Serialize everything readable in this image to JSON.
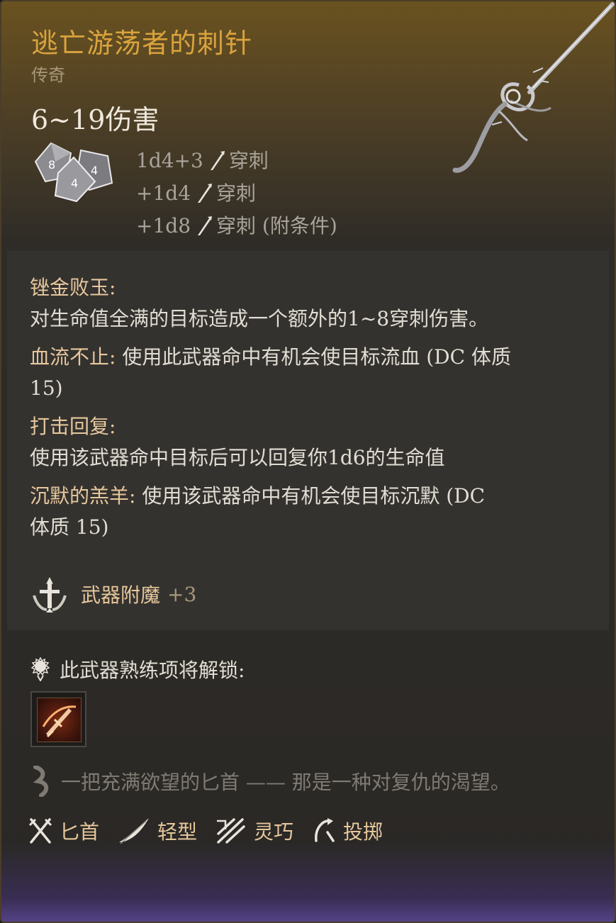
{
  "item": {
    "name": "逃亡游荡者的刺针",
    "rarity": "传奇",
    "damage_total": "6~19伤害",
    "damage_lines": [
      {
        "dice": "1d4+3",
        "type": "穿刺",
        "icon": "piercing-icon"
      },
      {
        "dice": "+1d4",
        "type": "穿刺",
        "icon": "piercing-icon"
      },
      {
        "dice": "+1d8",
        "type": "穿刺 (附条件)",
        "icon": "piercing-icon"
      }
    ],
    "art_icon": "dagger-art"
  },
  "perks": [
    {
      "name": "锉金败玉:",
      "desc": "对生命值全满的目标造成一个额外的1~8穿刺伤害。"
    },
    {
      "name": "血流不止:",
      "desc": " 使用此武器命中有机会使目标流血 (DC 体质 15)"
    },
    {
      "name": "打击回复:",
      "desc": "使用该武器命中目标后可以回复你1d6的生命值"
    },
    {
      "name": "沉默的羔羊:",
      "desc": " 使用该武器命中有机会使目标沉默 (DC 体质 15)"
    }
  ],
  "enchant": {
    "label": "武器附魔",
    "value": "+3",
    "icon": "enchant-icon"
  },
  "proficiency": {
    "header": "此武器熟练项将解锁:",
    "icon": "proficiency-icon",
    "action_icon": "bleed-slash-icon"
  },
  "flavor": {
    "text": "一把充满欲望的匕首 —— 那是一种对复仇的渴望。",
    "icon": "quill-icon"
  },
  "tags": [
    {
      "label": "匕首",
      "icon": "crossed-daggers-icon"
    },
    {
      "label": "轻型",
      "icon": "feather-icon"
    },
    {
      "label": "灵巧",
      "icon": "finesse-icon"
    },
    {
      "label": "投掷",
      "icon": "thrown-icon"
    }
  ],
  "colors": {
    "title": "#d9a33d",
    "perk_name": "#e6c79c",
    "body": "#e2ddd3",
    "muted": "#a8987a"
  }
}
